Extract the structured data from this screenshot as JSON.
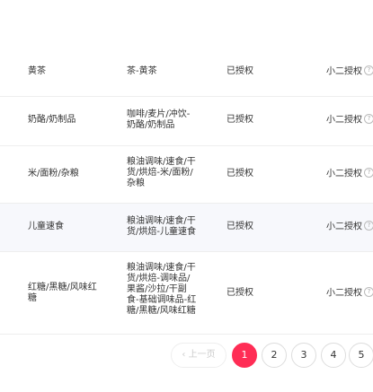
{
  "rows": [
    {
      "name": "黄茶",
      "category": [
        "茶-黄茶"
      ],
      "status": "已授权",
      "grantor": "小二授权"
    },
    {
      "name": "奶酪/奶制品",
      "category": [
        "咖啡/麦片/冲饮-",
        "奶酪/奶制品"
      ],
      "status": "已授权",
      "grantor": "小二授权"
    },
    {
      "name": "米/面粉/杂粮",
      "category": [
        "粮油调味/速食/干",
        "货/烘焙-米/面粉/",
        "杂粮"
      ],
      "status": "已授权",
      "grantor": "小二授权"
    },
    {
      "name": "儿童速食",
      "category": [
        "粮油调味/速食/干",
        "货/烘焙-儿童速食"
      ],
      "status": "已授权",
      "grantor": "小二授权"
    },
    {
      "name": [
        "红糖/黑糖/风味红",
        "糖"
      ],
      "category": [
        "粮油调味/速食/干",
        "货/烘焙-调味品/",
        "果酱/沙拉/干副",
        "食-基础调味品-红",
        "糖/黑糖/风味红糖"
      ],
      "status": "已授权",
      "grantor": "小二授权"
    }
  ],
  "help_icon": "?",
  "pagination": {
    "prev_label": "‹ 上一页",
    "pages": [
      "1",
      "2",
      "3",
      "4",
      "5"
    ],
    "current": "1"
  }
}
